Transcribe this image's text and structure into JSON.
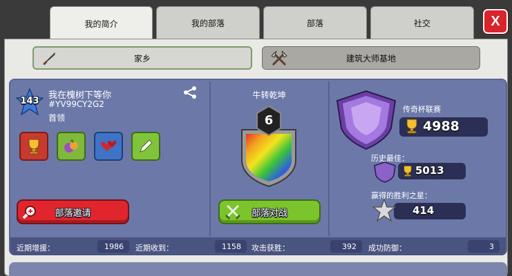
{
  "tabs": [
    {
      "label": "我的简介"
    },
    {
      "label": "我的部落"
    },
    {
      "label": "部落"
    },
    {
      "label": "社交"
    }
  ],
  "close_label": "X",
  "subtabs": {
    "home": "家乡",
    "builder": "建筑大师基地"
  },
  "profile": {
    "level": "143",
    "name": "我在槐树下等你",
    "tag": "#YV99CY2G2",
    "role": "首领"
  },
  "clan": {
    "name": "牛转乾坤",
    "badge_level": "6"
  },
  "league": {
    "name": "传奇杯联赛",
    "trophies": "4988",
    "best_label": "历史最佳：",
    "best_trophies": "5013",
    "war_stars_label": "赢得的胜利之星：",
    "war_stars": "414"
  },
  "buttons": {
    "invite": "部落邀请",
    "clan_war": "部落对战"
  },
  "stats": [
    {
      "label": "近期增援：",
      "value": "1986"
    },
    {
      "label": "近期收到：",
      "value": "1158"
    },
    {
      "label": "攻击获胜：",
      "value": "392"
    },
    {
      "label": "成功防御：",
      "value": "3"
    }
  ],
  "colors": {
    "panel": "#6c79a8",
    "invite_button": "#e0262c",
    "war_button": "#7cc42c",
    "league_shield": "#8a62c8",
    "close_button": "#d8242a"
  }
}
